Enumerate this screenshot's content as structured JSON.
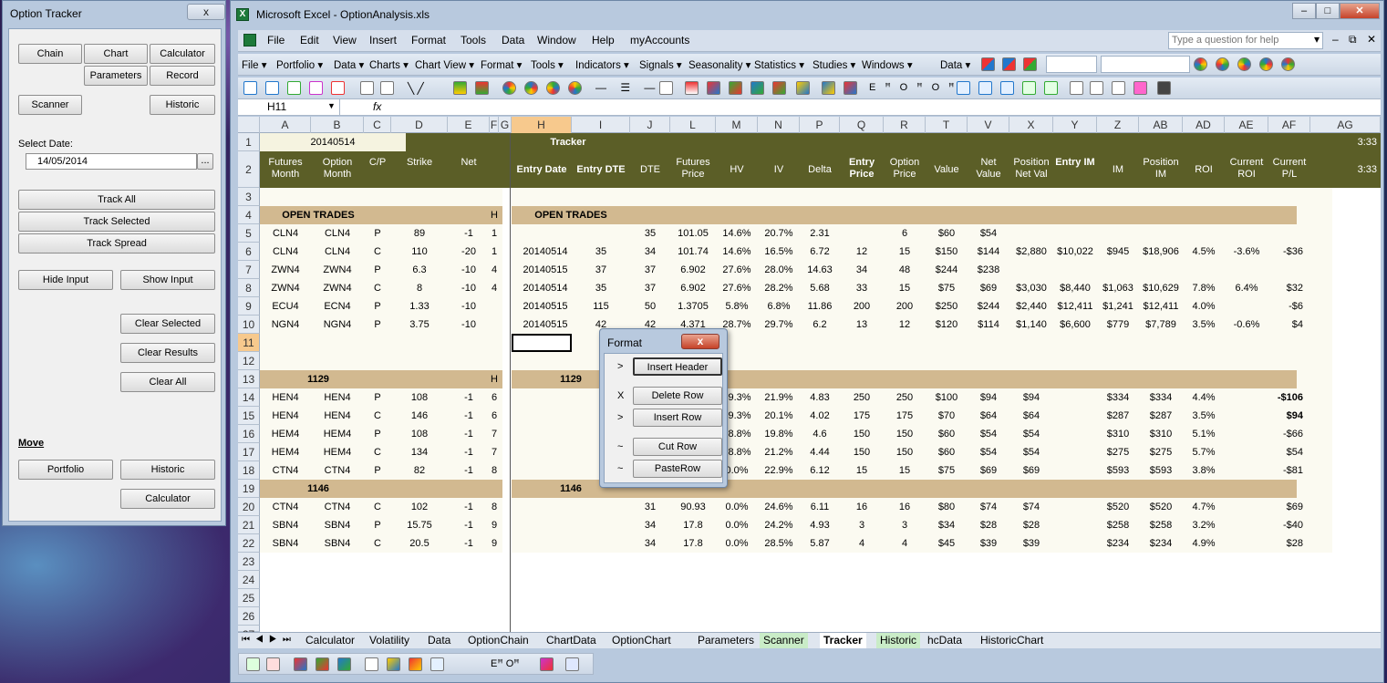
{
  "option_tracker": {
    "title": "Option Tracker",
    "close": "x",
    "buttons": {
      "chain": "Chain",
      "chart": "Chart",
      "calculator": "Calculator",
      "parameters": "Parameters",
      "record": "Record",
      "scanner": "Scanner",
      "historic": "Historic",
      "track_all": "Track All",
      "track_selected": "Track Selected",
      "track_spread": "Track Spread",
      "hide_input": "Hide Input",
      "show_input": "Show Input",
      "clear_selected": "Clear Selected",
      "clear_results": "Clear Results",
      "clear_all": "Clear All",
      "portfolio": "Portfolio",
      "historic2": "Historic",
      "calculator2": "Calculator"
    },
    "select_date_label": "Select Date:",
    "select_date_value": "14/05/2014",
    "date_btn": "...",
    "move_label": "Move"
  },
  "excel": {
    "title": "Microsoft Excel - OptionAnalysis.xls",
    "menu": [
      "File",
      "Edit",
      "View",
      "Insert",
      "Format",
      "Tools",
      "Data",
      "Window",
      "Help",
      "myAccounts"
    ],
    "ask_placeholder": "Type a question for help",
    "toolbar2": [
      "File ▾",
      "Portfolio ▾",
      "Data ▾",
      "Charts ▾",
      "Chart View ▾",
      "Format ▾",
      "Tools ▾",
      "Indicators ▾",
      "Signals ▾",
      "Seasonality ▾",
      "Statistics ▾",
      "Studies ▾",
      "Windows ▾"
    ],
    "toolbar2_extra": "Data ▾",
    "name_box": "H11",
    "fx": "fx",
    "columns": [
      "A",
      "B",
      "C",
      "D",
      "E",
      "F",
      "G",
      "H",
      "I",
      "J",
      "L",
      "M",
      "N",
      "P",
      "Q",
      "R",
      "T",
      "V",
      "X",
      "Y",
      "Z",
      "AB",
      "AD",
      "AE",
      "AF",
      "AG"
    ],
    "sheet_tabs": [
      "Calculator",
      "Volatility",
      "Data",
      "OptionChain",
      "ChartData",
      "OptionChart",
      "Parameters",
      "Scanner",
      "Tracker",
      "Historic",
      "hcData",
      "HistoricChart"
    ]
  },
  "sheet": {
    "date_cell": "20140514",
    "tracker_title": "Tracker",
    "time": "3:33",
    "headers_left": [
      "Futures Month",
      "Option Month",
      "C/P",
      "Strike",
      "Net"
    ],
    "headers_right": [
      "Entry Date",
      "Entry DTE",
      "DTE",
      "Futures Price",
      "HV",
      "IV",
      "Delta",
      "Entry Price",
      "Option Price",
      "Value",
      "Net Value",
      "Position Net Val",
      "Entry IM",
      "IM",
      "Position IM",
      "ROI",
      "Current ROI",
      "Current P/L"
    ],
    "section_open": "OPEN TRADES",
    "section_1129": "1129",
    "section_1146": "1146",
    "h_flag": "H",
    "rows": [
      {
        "r": "5",
        "a": "CLN4",
        "b": "CLN4",
        "c": "P",
        "d": "89",
        "e": "-1",
        "f": "1",
        "h": "",
        "i": "",
        "j": "35",
        "l": "101.05",
        "m": "14.6%",
        "n": "20.7%",
        "p": "2.31",
        "q": "",
        "rr": "6",
        "t": "$60",
        "v": "$54",
        "x": "",
        "y": "",
        "z": "",
        "ab": "",
        "ad": "",
        "ae": "",
        "af": ""
      },
      {
        "r": "6",
        "a": "CLN4",
        "b": "CLN4",
        "c": "C",
        "d": "110",
        "e": "-20",
        "f": "1",
        "h": "20140514",
        "i": "35",
        "j": "34",
        "l": "101.74",
        "m": "14.6%",
        "n": "16.5%",
        "p": "6.72",
        "q": "12",
        "rr": "15",
        "t": "$150",
        "v": "$144",
        "x": "$2,880",
        "y": "$10,022",
        "z": "$945",
        "ab": "$18,906",
        "ad": "4.5%",
        "ae": "-3.6%",
        "af": "-$36"
      },
      {
        "r": "7",
        "a": "ZWN4",
        "b": "ZWN4",
        "c": "P",
        "d": "6.3",
        "e": "-10",
        "f": "4",
        "h": "20140515",
        "i": "37",
        "j": "37",
        "l": "6.902",
        "m": "27.6%",
        "n": "28.0%",
        "p": "14.63",
        "q": "34",
        "rr": "48",
        "t": "$244",
        "v": "$238",
        "x": "",
        "y": "",
        "z": "",
        "ab": "",
        "ad": "",
        "ae": "",
        "af": ""
      },
      {
        "r": "8",
        "a": "ZWN4",
        "b": "ZWN4",
        "c": "C",
        "d": "8",
        "e": "-10",
        "f": "4",
        "h": "20140514",
        "i": "35",
        "j": "37",
        "l": "6.902",
        "m": "27.6%",
        "n": "28.2%",
        "p": "5.68",
        "q": "33",
        "rr": "15",
        "t": "$75",
        "v": "$69",
        "x": "$3,030",
        "y": "$8,440",
        "z": "$1,063",
        "ab": "$10,629",
        "ad": "7.8%",
        "ae": "6.4%",
        "af": "$32"
      },
      {
        "r": "9",
        "a": "ECU4",
        "b": "ECN4",
        "c": "P",
        "d": "1.33",
        "e": "-10",
        "f": "",
        "h": "20140515",
        "i": "115",
        "j": "50",
        "l": "1.3705",
        "m": "5.8%",
        "n": "6.8%",
        "p": "11.86",
        "q": "200",
        "rr": "200",
        "t": "$250",
        "v": "$244",
        "x": "$2,440",
        "y": "$12,411",
        "z": "$1,241",
        "ab": "$12,411",
        "ad": "4.0%",
        "ae": "",
        "af": "-$6"
      },
      {
        "r": "10",
        "a": "NGN4",
        "b": "NGN4",
        "c": "P",
        "d": "3.75",
        "e": "-10",
        "f": "",
        "h": "20140515",
        "i": "42",
        "j": "42",
        "l": "4.371",
        "m": "28.7%",
        "n": "29.7%",
        "p": "6.2",
        "q": "13",
        "rr": "12",
        "t": "$120",
        "v": "$114",
        "x": "$1,140",
        "y": "$6,600",
        "z": "$779",
        "ab": "$7,789",
        "ad": "3.5%",
        "ae": "-0.6%",
        "af": "$4"
      },
      {
        "r": "14",
        "a": "HEN4",
        "b": "HEN4",
        "c": "P",
        "d": "108",
        "e": "-1",
        "f": "6",
        "h": "",
        "i": "",
        "j": "",
        "l": "",
        "m": "19.3%",
        "n": "21.9%",
        "p": "4.83",
        "q": "250",
        "rr": "250",
        "t": "$100",
        "v": "$94",
        "x": "$94",
        "y": "",
        "z": "$334",
        "ab": "$334",
        "ad": "4.4%",
        "ae": "",
        "af": "-$106"
      },
      {
        "r": "15",
        "a": "HEN4",
        "b": "HEN4",
        "c": "C",
        "d": "146",
        "e": "-1",
        "f": "6",
        "h": "",
        "i": "",
        "j": "",
        "l": "",
        "m": "19.3%",
        "n": "20.1%",
        "p": "4.02",
        "q": "175",
        "rr": "175",
        "t": "$70",
        "v": "$64",
        "x": "$64",
        "y": "",
        "z": "$287",
        "ab": "$287",
        "ad": "3.5%",
        "ae": "",
        "af": "$94"
      },
      {
        "r": "16",
        "a": "HEM4",
        "b": "HEM4",
        "c": "P",
        "d": "108",
        "e": "-1",
        "f": "7",
        "h": "",
        "i": "",
        "j": "",
        "l": "",
        "m": "18.8%",
        "n": "19.8%",
        "p": "4.6",
        "q": "150",
        "rr": "150",
        "t": "$60",
        "v": "$54",
        "x": "$54",
        "y": "",
        "z": "$310",
        "ab": "$310",
        "ad": "5.1%",
        "ae": "",
        "af": "-$66"
      },
      {
        "r": "17",
        "a": "HEM4",
        "b": "HEM4",
        "c": "C",
        "d": "134",
        "e": "-1",
        "f": "7",
        "h": "",
        "i": "",
        "j": "",
        "l": "",
        "m": "18.8%",
        "n": "21.2%",
        "p": "4.44",
        "q": "150",
        "rr": "150",
        "t": "$60",
        "v": "$54",
        "x": "$54",
        "y": "",
        "z": "$275",
        "ab": "$275",
        "ad": "5.7%",
        "ae": "",
        "af": "$54"
      },
      {
        "r": "18",
        "a": "CTN4",
        "b": "CTN4",
        "c": "P",
        "d": "82",
        "e": "-1",
        "f": "8",
        "h": "",
        "i": "",
        "j": "",
        "l": "",
        "m": "0.0%",
        "n": "22.9%",
        "p": "6.12",
        "q": "15",
        "rr": "15",
        "t": "$75",
        "v": "$69",
        "x": "$69",
        "y": "",
        "z": "$593",
        "ab": "$593",
        "ad": "3.8%",
        "ae": "",
        "af": "-$81"
      },
      {
        "r": "20",
        "a": "CTN4",
        "b": "CTN4",
        "c": "C",
        "d": "102",
        "e": "-1",
        "f": "8",
        "h": "",
        "i": "",
        "j": "31",
        "l": "90.93",
        "m": "0.0%",
        "n": "24.6%",
        "p": "6.11",
        "q": "16",
        "rr": "16",
        "t": "$80",
        "v": "$74",
        "x": "$74",
        "y": "",
        "z": "$520",
        "ab": "$520",
        "ad": "4.7%",
        "ae": "",
        "af": "$69"
      },
      {
        "r": "21",
        "a": "SBN4",
        "b": "SBN4",
        "c": "P",
        "d": "15.75",
        "e": "-1",
        "f": "9",
        "h": "",
        "i": "",
        "j": "34",
        "l": "17.8",
        "m": "0.0%",
        "n": "24.2%",
        "p": "4.93",
        "q": "3",
        "rr": "3",
        "t": "$34",
        "v": "$28",
        "x": "$28",
        "y": "",
        "z": "$258",
        "ab": "$258",
        "ad": "3.2%",
        "ae": "",
        "af": "-$40"
      },
      {
        "r": "22",
        "a": "SBN4",
        "b": "SBN4",
        "c": "C",
        "d": "20.5",
        "e": "-1",
        "f": "9",
        "h": "",
        "i": "",
        "j": "34",
        "l": "17.8",
        "m": "0.0%",
        "n": "28.5%",
        "p": "5.87",
        "q": "4",
        "rr": "4",
        "t": "$45",
        "v": "$39",
        "x": "$39",
        "y": "",
        "z": "$234",
        "ab": "$234",
        "ad": "4.9%",
        "ae": "",
        "af": "$28"
      }
    ]
  },
  "format_dialog": {
    "title": "Format",
    "close": "x",
    "items": [
      {
        "sym": ">",
        "label": "Insert Header"
      },
      {
        "sym": "X",
        "label": "Delete Row"
      },
      {
        "sym": ">",
        "label": "Insert Row"
      },
      {
        "sym": "~",
        "label": "Cut Row"
      },
      {
        "sym": "~",
        "label": "PasteRow"
      }
    ]
  }
}
